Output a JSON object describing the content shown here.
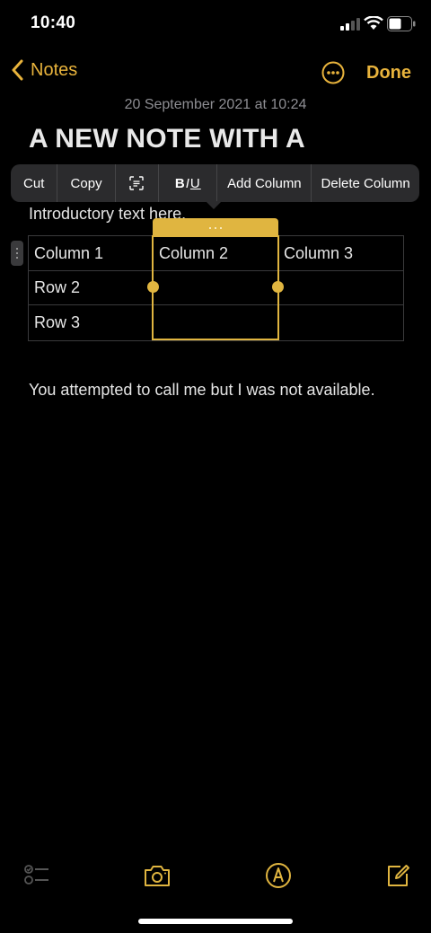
{
  "status": {
    "time": "10:40"
  },
  "nav": {
    "back_label": "Notes",
    "done_label": "Done"
  },
  "note": {
    "date": "20 September 2021 at 10:24",
    "title": "A NEW NOTE WITH A",
    "intro": "Introductory text here.",
    "body": "You attempted to call me but I was not available."
  },
  "menu": {
    "cut": "Cut",
    "copy": "Copy",
    "add_column": "Add Column",
    "delete_column": "Delete Column"
  },
  "table": {
    "row1": [
      "Column 1",
      "Column 2",
      "Column 3"
    ],
    "row2": [
      "Row 2",
      "",
      ""
    ],
    "row3": [
      "Row 3",
      "",
      ""
    ]
  },
  "colors": {
    "accent": "#e0b540",
    "background": "#000000",
    "menu": "#2b2b2d"
  },
  "icons": [
    "back-chevron-icon",
    "more-icon",
    "scan-text-icon",
    "checklist-icon",
    "camera-icon",
    "markup-icon",
    "compose-icon"
  ]
}
